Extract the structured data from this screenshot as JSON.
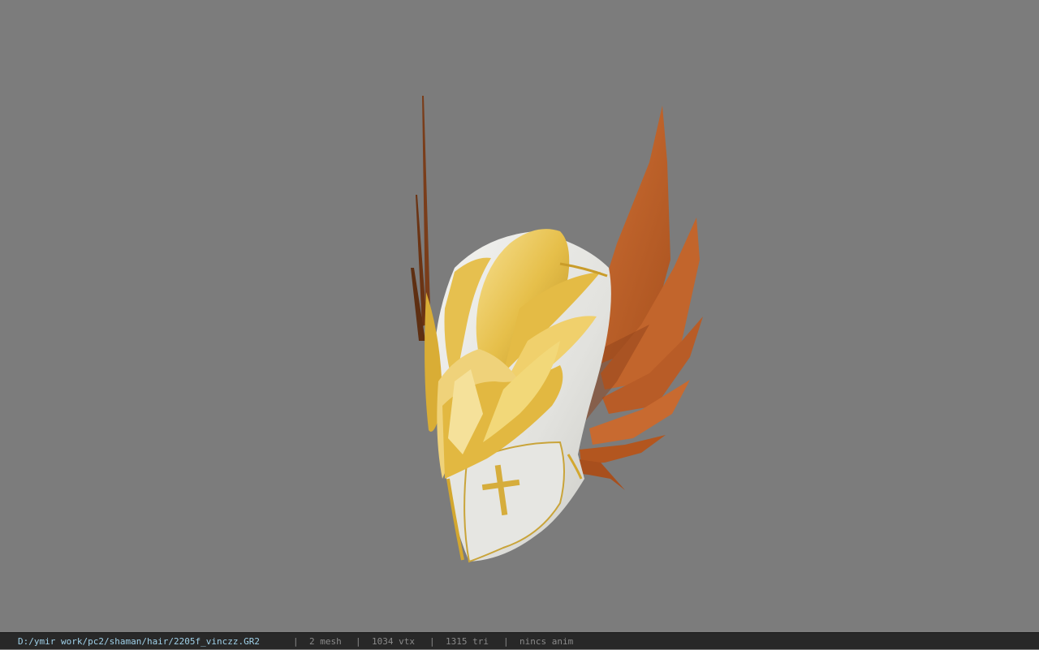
{
  "viewer": {
    "background_color": "#7c7c7c",
    "model": {
      "icon": "winged-helmet-3d-model",
      "colors": {
        "silver": "#e8e8e4",
        "gold": "#e9c65a",
        "gold_dark": "#b88d22",
        "wings": "#c2652c",
        "wings_dark": "#8f4219"
      }
    }
  },
  "status_bar": {
    "file_path": "D:/ymir work/pc2/shaman/hair/2205f_vinczz.GR2",
    "separator": "|",
    "mesh_count": "2 mesh",
    "vertex_count": "1034 vtx",
    "triangle_count": "1315 tri",
    "anim_status": "nincs anim",
    "text_color": "#8a8a8a",
    "path_color": "#9fd0e8",
    "background_color": "#282828"
  }
}
